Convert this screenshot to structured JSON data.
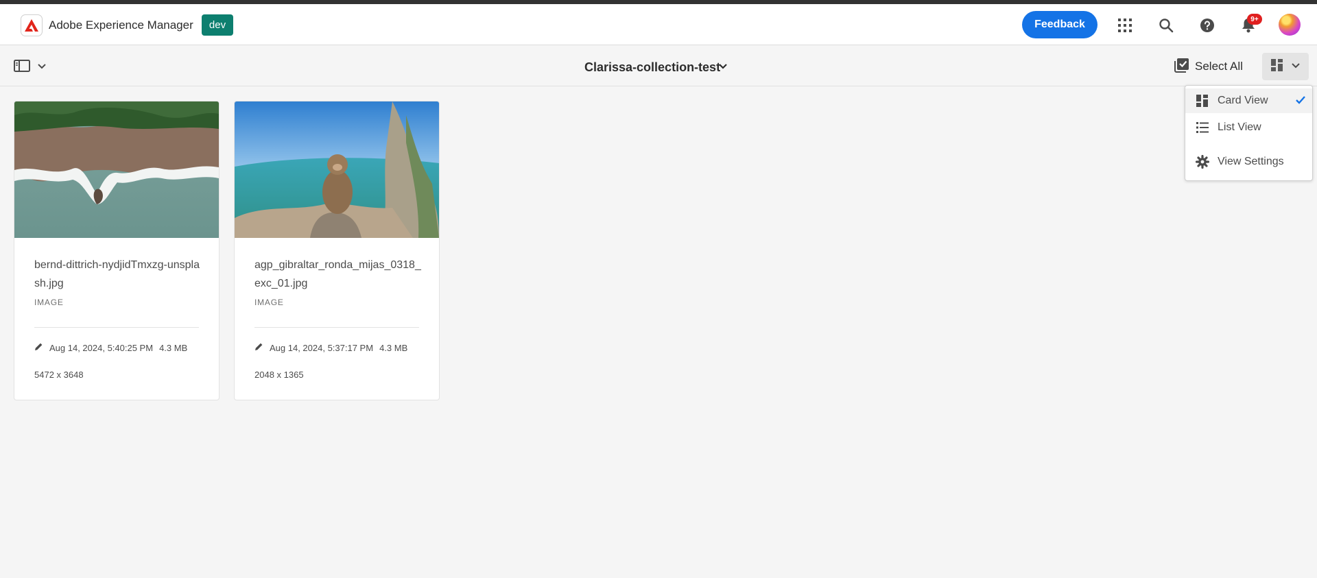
{
  "header": {
    "app_title": "Adobe Experience Manager",
    "env_badge": "dev",
    "feedback_label": "Feedback",
    "notification_count": "9+",
    "icons": [
      "app-switcher-icon",
      "search-icon",
      "help-icon",
      "bell-icon"
    ]
  },
  "toolbar": {
    "collection_title": "Clarissa-collection-test",
    "select_all_label": "Select All"
  },
  "view_menu": {
    "items": [
      {
        "label": "Card View",
        "icon": "card-view-icon",
        "selected": true
      },
      {
        "label": "List View",
        "icon": "list-view-icon",
        "selected": false
      },
      {
        "label": "View Settings",
        "icon": "gear-icon",
        "selected": false
      }
    ]
  },
  "assets": [
    {
      "name": "bernd-dittrich-nydjidTmxzg-unsplash.jpg",
      "type": "IMAGE",
      "modified": "Aug 14, 2024, 5:40:25 PM",
      "size": "4.3 MB",
      "dimensions": "5472 x 3648"
    },
    {
      "name": "agp_gibraltar_ronda_mijas_0318_exc_01.jpg",
      "type": "IMAGE",
      "modified": "Aug 14, 2024, 5:37:17 PM",
      "size": "4.3 MB",
      "dimensions": "2048 x 1365"
    }
  ],
  "colors": {
    "accent": "#1473e6",
    "env_badge": "#0d7f6f",
    "notification": "#e02020"
  }
}
